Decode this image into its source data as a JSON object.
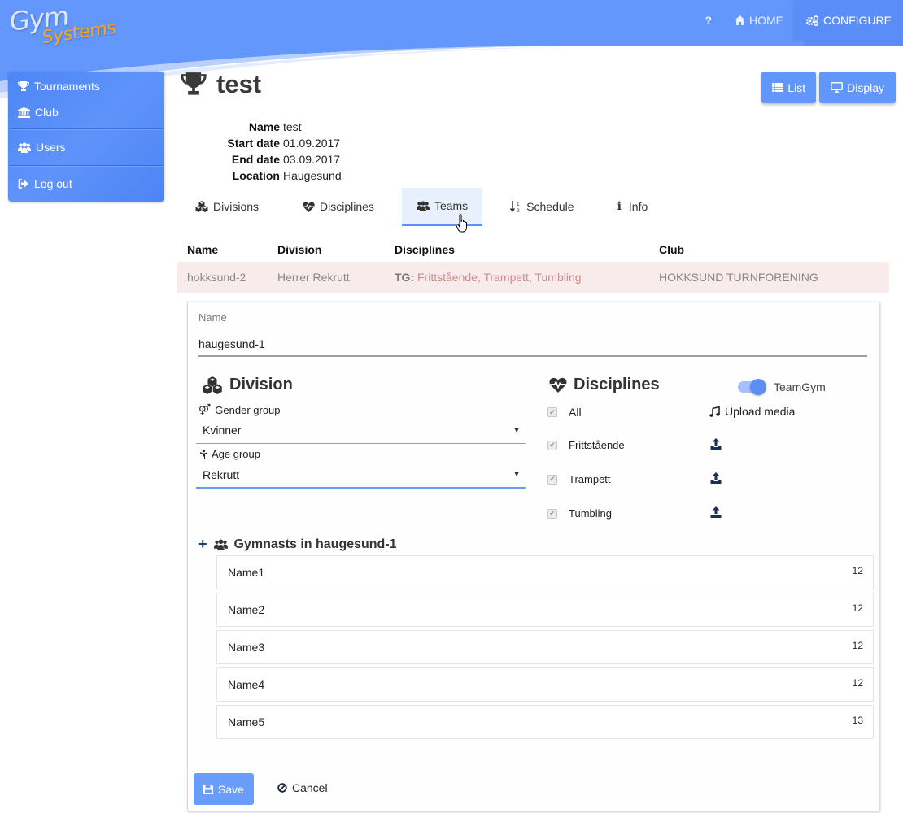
{
  "brand": {
    "line1": "Gym",
    "line2": "Systems",
    "primary_color": "#6197fb",
    "accent_color": "#f5a623"
  },
  "topnav": {
    "help_label": "?",
    "home_label": "HOME",
    "configure_label": "CONFIGURE"
  },
  "sidebar": {
    "items": [
      {
        "label": "Tournaments",
        "icon": "trophy-icon"
      },
      {
        "label": "Club",
        "icon": "bank-icon"
      },
      {
        "label": "Users",
        "icon": "users-icon"
      },
      {
        "label": "Log out",
        "icon": "logout-icon"
      }
    ]
  },
  "page": {
    "title": "test",
    "list_button": "List",
    "display_button": "Display"
  },
  "tournament_info": [
    {
      "key": "Name",
      "value": "test"
    },
    {
      "key": "Start date",
      "value": "01.09.2017"
    },
    {
      "key": "End date",
      "value": "03.09.2017"
    },
    {
      "key": "Location",
      "value": "Haugesund"
    }
  ],
  "tabs": [
    {
      "label": "Divisions",
      "active": false
    },
    {
      "label": "Disciplines",
      "active": false
    },
    {
      "label": "Teams",
      "active": true
    },
    {
      "label": "Schedule",
      "active": false
    },
    {
      "label": "Info",
      "active": false
    }
  ],
  "teams_table": {
    "headers": [
      "Name",
      "Division",
      "Disciplines",
      "Club"
    ],
    "rows": [
      {
        "name": "hokksund-2",
        "division": "Herrer Rekrutt",
        "disciplines_prefix": "TG:",
        "disciplines": "Frittstående, Trampett, Tumbling",
        "club": "HOKKSUND TURNFORENING"
      }
    ]
  },
  "edit_form": {
    "name_label": "Name",
    "name_value": "haugesund-1",
    "division_title": "Division",
    "gender_label": "Gender group",
    "gender_value": "Kvinner",
    "age_label": "Age group",
    "age_value": "Rekrutt",
    "disciplines_title": "Disciplines",
    "teamgym_label": "TeamGym",
    "teamgym_on": true,
    "upload_media_label": "Upload media",
    "disciplines": [
      {
        "label": "All",
        "checked": true
      },
      {
        "label": "Frittstående",
        "checked": true
      },
      {
        "label": "Trampett",
        "checked": true
      },
      {
        "label": "Tumbling",
        "checked": true
      }
    ],
    "gymnasts_title": "Gymnasts in haugesund-1",
    "add_label": "+",
    "gymnasts": [
      {
        "name": "Name1",
        "value": "12"
      },
      {
        "name": "Name2",
        "value": "12"
      },
      {
        "name": "Name3",
        "value": "12"
      },
      {
        "name": "Name4",
        "value": "12"
      },
      {
        "name": "Name5",
        "value": "13"
      }
    ],
    "save_label": "Save",
    "cancel_label": "Cancel"
  }
}
